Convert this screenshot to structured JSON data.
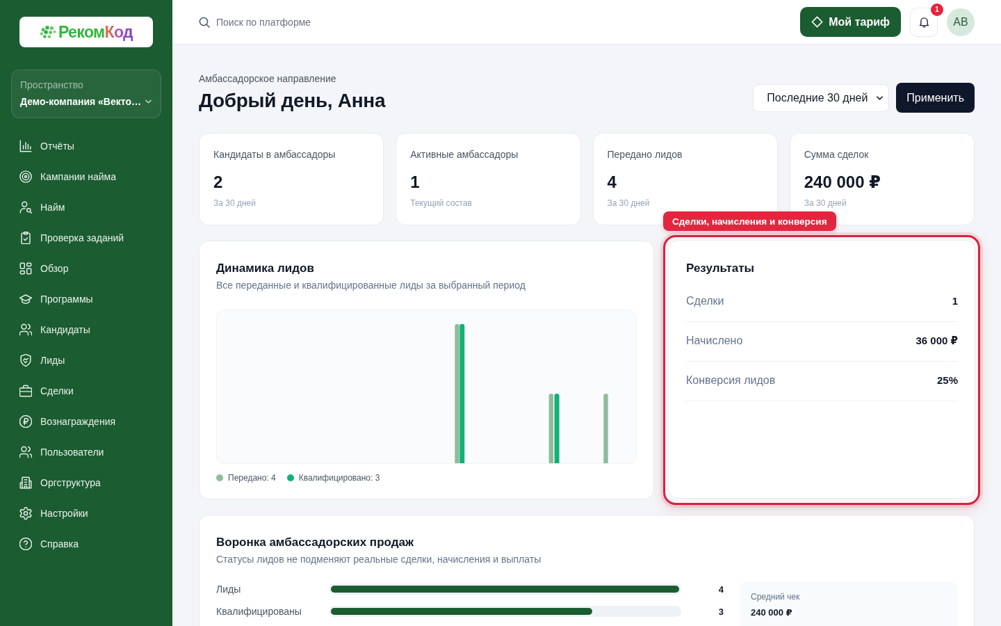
{
  "sidebar": {
    "logo": {
      "parts": [
        "Реком",
        "Код"
      ]
    },
    "workspace": {
      "label": "Пространство",
      "value": "Демо-компания «Векто…"
    },
    "nav": [
      {
        "label": "Отчёты"
      },
      {
        "label": "Кампании найма"
      },
      {
        "label": "Найм"
      },
      {
        "label": "Проверка заданий"
      },
      {
        "label": "Обзор"
      },
      {
        "label": "Программы"
      },
      {
        "label": "Кандидаты"
      },
      {
        "label": "Лиды"
      },
      {
        "label": "Сделки"
      },
      {
        "label": "Вознаграждения"
      },
      {
        "label": "Пользователи"
      },
      {
        "label": "Оргструктура"
      },
      {
        "label": "Настройки"
      },
      {
        "label": "Справка"
      }
    ]
  },
  "header": {
    "search": {
      "placeholder": "Поиск по платформе"
    },
    "plan_button": "Мой тариф",
    "notifications": {
      "badge": "1"
    },
    "avatar": "АВ"
  },
  "page": {
    "eyebrow": "Амбассадорское направление",
    "title": "Добрый день, Анна",
    "period_select": {
      "value": "Последние 30 дней"
    },
    "apply_button": "Применить"
  },
  "stats": [
    {
      "label": "Кандидаты в амбассадоры",
      "value": "2",
      "note": "За 30 дней"
    },
    {
      "label": "Активные амбассадоры",
      "value": "1",
      "note": "Текущий состав"
    },
    {
      "label": "Передано лидов",
      "value": "4",
      "note": "За 30 дней"
    },
    {
      "label": "Сумма сделок",
      "value": "240 000 ₽",
      "note": "За 30 дней"
    }
  ],
  "lead_dynamics": {
    "title": "Динамика лидов",
    "subtitle": "Все переданные и квалифицированные лиды за выбранный период",
    "legend": [
      {
        "label": "Передано: 4",
        "color": "#8fbd9b"
      },
      {
        "label": "Квалифицировано: 3",
        "color": "#12b07a"
      }
    ]
  },
  "results": {
    "highlight": {
      "label": "Сделки, начисления и конверсия"
    },
    "title": "Результаты",
    "rows": [
      {
        "label": "Сделки",
        "value": "1"
      },
      {
        "label": "Начислено",
        "value": "36 000 ₽"
      },
      {
        "label": "Конверсия лидов",
        "value": "25%"
      }
    ]
  },
  "funnel": {
    "title": "Воронка амбассадорских продаж",
    "subtitle": "Статусы лидов не подменяют реальные сделки, начисления и выплаты",
    "rows": [
      {
        "label": "Лиды",
        "value": "4",
        "level": 1
      },
      {
        "label": "Квалифицированы",
        "value": "3",
        "level": 0.75
      }
    ],
    "average_check": {
      "label": "Средний чек",
      "value": "240 000 ₽"
    }
  }
}
